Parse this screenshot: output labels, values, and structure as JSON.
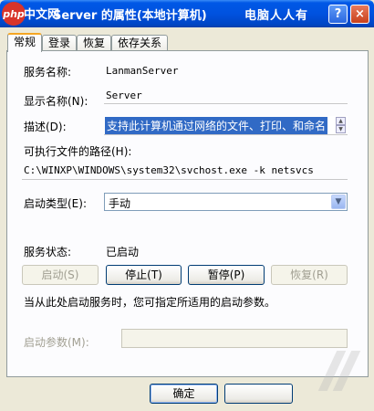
{
  "window": {
    "logo": "php",
    "logo_cn": "中文网",
    "title": "Server 的属性(本地计算机)",
    "watermark": "电脑人人有",
    "help_label": "?",
    "close_label": "×"
  },
  "tabs": [
    {
      "label": "常规",
      "active": true
    },
    {
      "label": "登录",
      "active": false
    },
    {
      "label": "恢复",
      "active": false
    },
    {
      "label": "依存关系",
      "active": false
    }
  ],
  "general": {
    "service_name_label": "服务名称:",
    "service_name": "LanmanServer",
    "display_name_label": "显示名称(N):",
    "display_name": "Server",
    "description_label": "描述(D):",
    "description": "支持此计算机通过网络的文件、打印、和命名",
    "exe_path_label": "可执行文件的路径(H):",
    "exe_path": "C:\\WINXP\\WINDOWS\\system32\\svchost.exe -k netsvcs",
    "startup_type_label": "启动类型(E):",
    "startup_type": "手动",
    "status_label": "服务状态:",
    "status": "已启动"
  },
  "buttons": {
    "start": "启动(S)",
    "stop": "停止(T)",
    "pause": "暂停(P)",
    "resume": "恢复(R)"
  },
  "hint": "当从此处启动服务时，您可指定所适用的启动参数。",
  "params": {
    "label": "启动参数(M):",
    "value": ""
  },
  "footer": {
    "ok": "确定"
  }
}
